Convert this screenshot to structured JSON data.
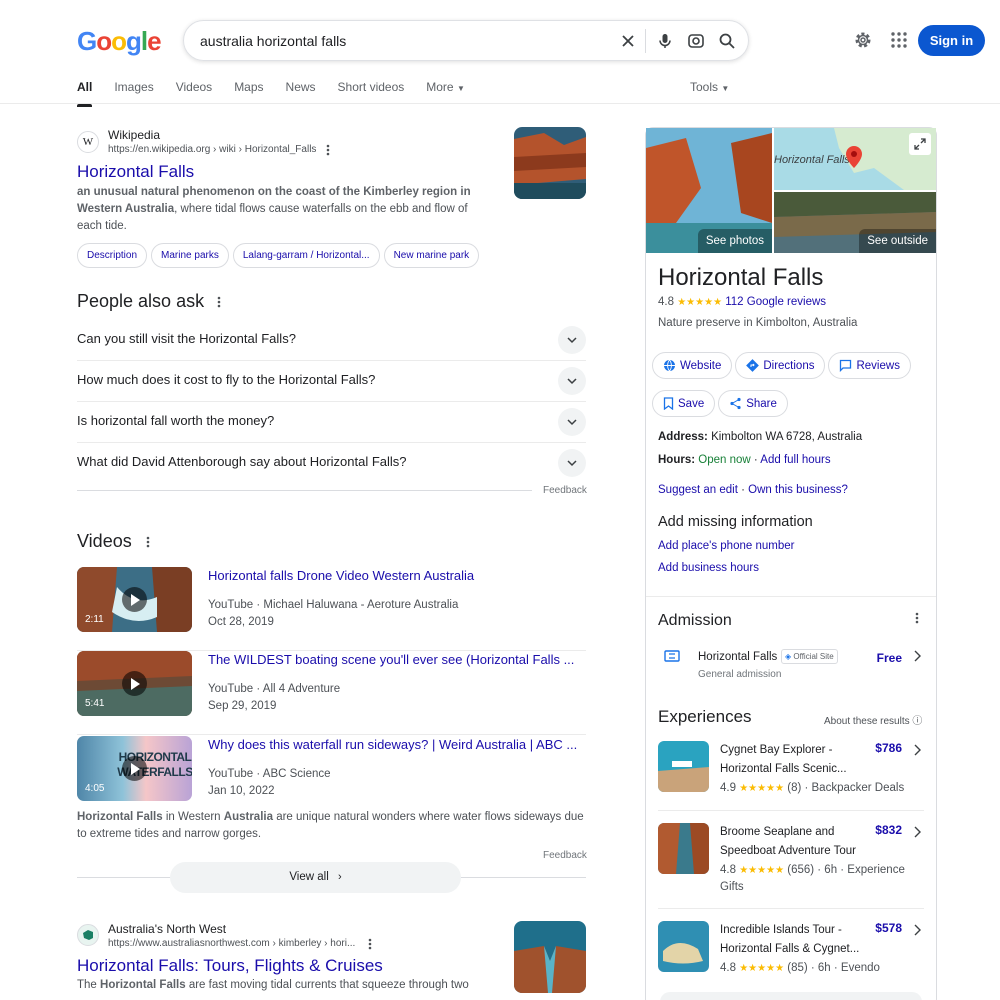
{
  "header": {
    "logo": [
      "G",
      "o",
      "o",
      "g",
      "l",
      "e"
    ],
    "logo_colors": [
      "#4285f4",
      "#ea4335",
      "#fbbc05",
      "#4285f4",
      "#34a853",
      "#ea4335"
    ],
    "query": "australia horizontal falls",
    "signin": "Sign in"
  },
  "tabs": [
    {
      "label": "All",
      "active": true
    },
    {
      "label": "Images"
    },
    {
      "label": "Videos"
    },
    {
      "label": "Maps"
    },
    {
      "label": "News"
    },
    {
      "label": "Short videos"
    },
    {
      "label": "More"
    }
  ],
  "tools": "Tools",
  "result1": {
    "favicon": "W",
    "site": "Wikipedia",
    "url": "https://en.wikipedia.org › wiki › Horizontal_Falls",
    "title": "Horizontal Falls",
    "snippet_bold": "an unusual natural phenomenon on the coast of the Kimberley region in Western Australia",
    "snippet_rest": ", where tidal flows cause waterfalls on the ebb and flow of each tide.",
    "chips": [
      "Description",
      "Marine parks",
      "Lalang-garram / Horizontal...",
      "New marine park"
    ]
  },
  "paa": {
    "heading": "People also ask",
    "questions": [
      "Can you still visit the Horizontal Falls?",
      "How much does it cost to fly to the Horizontal Falls?",
      "Is horizontal fall worth the money?",
      "What did David Attenborough say about Horizontal Falls?"
    ],
    "feedback": "Feedback"
  },
  "videos": {
    "heading": "Videos",
    "items": [
      {
        "title": "Horizontal falls Drone Video Western Australia",
        "source": "YouTube · Michael Haluwana - Aeroture Australia",
        "date": "Oct 28, 2019",
        "duration": "2:11"
      },
      {
        "title": "The WILDEST boating scene you'll ever see (Horizontal Falls ...",
        "source": "YouTube · All 4 Adventure",
        "date": "Sep 29, 2019",
        "duration": "5:41"
      },
      {
        "title": "Why does this waterfall run sideways? | Weird Australia | ABC ...",
        "source": "YouTube · ABC Science",
        "date": "Jan 10, 2022",
        "duration": "4:05"
      }
    ],
    "thumb3_text": "HORIZONTAL WATERFALLS",
    "desc_b1": "Horizontal Falls",
    "desc_1": " in Western ",
    "desc_b2": "Australia",
    "desc_2": " are unique natural wonders where water flows sideways due to extreme tides and narrow gorges.",
    "feedback": "Feedback",
    "view_all": "View all"
  },
  "result2": {
    "site": "Australia's North West",
    "url": "https://www.australiasnorthwest.com › kimberley › hori...",
    "title": "Horizontal Falls: Tours, Flights & Cruises",
    "snippet_pre": "The ",
    "snippet_bold": "Horizontal Falls",
    "snippet_rest": " are fast moving tidal currents that squeeze through two"
  },
  "kp": {
    "see_photos": "See photos",
    "see_outside": "See outside",
    "map_label": "Horizontal Falls",
    "title": "Horizontal Falls",
    "rating": "4.8",
    "stars": "★★★★★",
    "reviews": "112 Google reviews",
    "category": "Nature preserve in Kimbolton, Australia",
    "buttons": [
      "Website",
      "Directions",
      "Reviews",
      "Save",
      "Share"
    ],
    "address_label": "Address:",
    "address": "Kimbolton WA 6728, Australia",
    "hours_label": "Hours:",
    "hours_status": "Open now",
    "hours_link": "Add full hours",
    "suggest": "Suggest an edit",
    "own": "Own this business?",
    "missing_heading": "Add missing information",
    "missing_phone": "Add place's phone number",
    "missing_hours": "Add business hours",
    "admission_heading": "Admission",
    "admission_name": "Horizontal Falls",
    "official": "Official Site",
    "admission_price": "Free",
    "admission_sub": "General admission",
    "experiences_heading": "Experiences",
    "about": "About these results",
    "experiences": [
      {
        "title": "Cygnet Bay Explorer - Horizontal Falls Scenic...",
        "price": "$786",
        "rating": "4.9",
        "stars": "★★★★★",
        "meta": "(8) · Backpacker Deals"
      },
      {
        "title": "Broome Seaplane and Speedboat Adventure Tour",
        "price": "$832",
        "rating": "4.8",
        "stars": "★★★★★",
        "meta": "(656) · 6h · Experience Gifts"
      },
      {
        "title": "Incredible Islands Tour - Horizontal Falls & Cygnet...",
        "price": "$578",
        "rating": "4.8",
        "stars": "★★★★★",
        "meta": "(85) · 6h · Evendo"
      }
    ]
  }
}
